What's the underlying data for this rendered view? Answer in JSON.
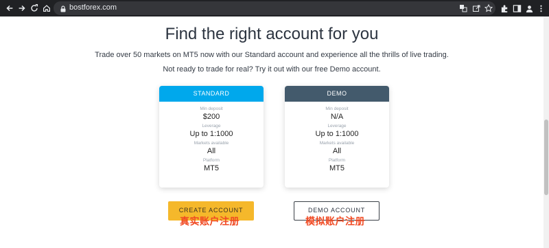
{
  "browser": {
    "url": "bostforex.com",
    "icons": [
      "back-icon",
      "forward-icon",
      "reload-icon",
      "home-icon",
      "lock-icon",
      "translate-icon",
      "share-icon",
      "star-icon",
      "extensions-icon",
      "sidebar-icon",
      "profile-icon",
      "menu-icon"
    ]
  },
  "page": {
    "heading": "Find the right account for you",
    "subtitle1": "Trade over 50 markets on MT5 now with our Standard account and experience all the thrills of live trading.",
    "subtitle2": "Not ready to trade for real? Try it out with our free Demo account."
  },
  "cards": {
    "standard": {
      "title": "STANDARD",
      "color": "#00a8ec",
      "min_deposit_label": "Min deposit",
      "min_deposit": "$200",
      "leverage_label": "Leverage",
      "leverage": "Up to 1:1000",
      "markets_label": "Markets available",
      "markets": "All",
      "platform_label": "Platform",
      "platform": "MT5"
    },
    "demo": {
      "title": "DEMO",
      "color": "#435a6c",
      "min_deposit_label": "Min deposit",
      "min_deposit": "N/A",
      "leverage_label": "Leverage",
      "leverage": "Up to 1:1000",
      "markets_label": "Markets available",
      "markets": "All",
      "platform_label": "Platform",
      "platform": "MT5"
    }
  },
  "buttons": {
    "create_label": "CREATE ACCOUNT",
    "create_overlay": "真实账户注册",
    "demo_label": "DEMO ACCOUNT",
    "demo_overlay": "模拟账户注册",
    "create_color": "#f5b82b",
    "overlay_color": "#f04a23"
  }
}
